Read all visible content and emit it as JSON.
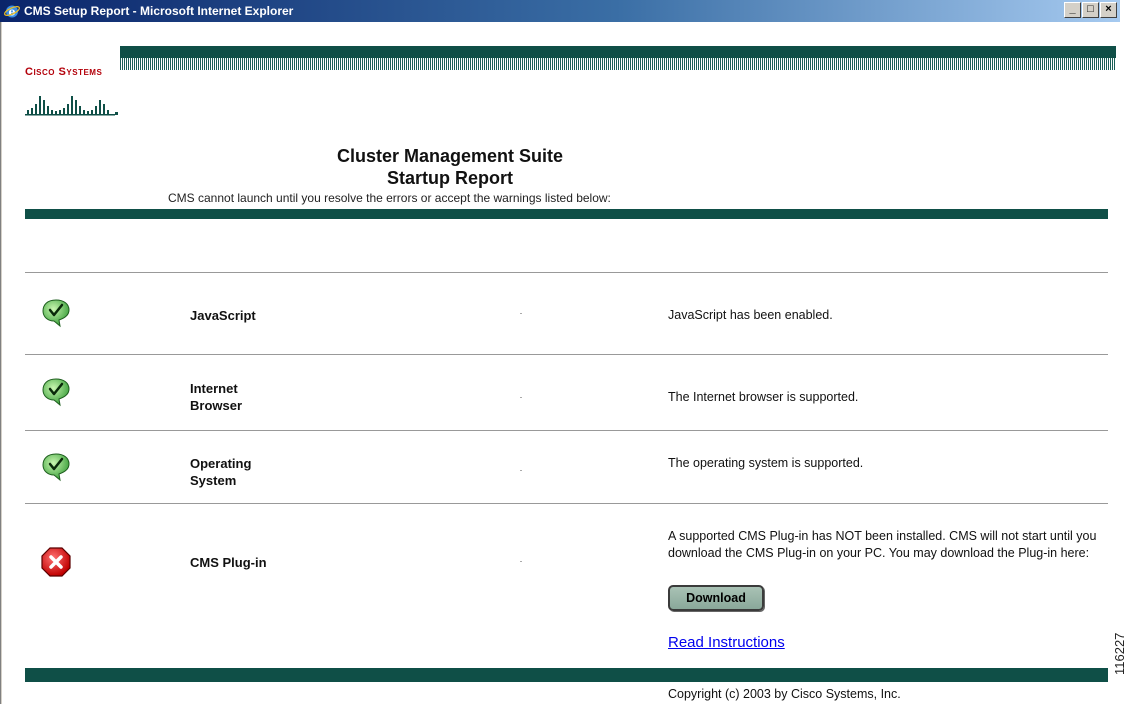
{
  "window": {
    "title": "CMS Setup Report - Microsoft Internet Explorer",
    "buttons": [
      "_",
      "□",
      "×"
    ]
  },
  "logo": {
    "text": "Cisco Systems"
  },
  "header": {
    "title_line1": "Cluster Management Suite",
    "title_line2": "Startup Report",
    "subtitle": "CMS cannot launch until you resolve the errors or accept the warnings listed below:"
  },
  "checks": [
    {
      "status": "ok",
      "name": "JavaScript",
      "message": "JavaScript has been enabled."
    },
    {
      "status": "ok",
      "name": "Internet Browser",
      "message": "The Internet browser is supported."
    },
    {
      "status": "ok",
      "name": "Operating System",
      "message": "The operating system is supported."
    },
    {
      "status": "error",
      "name": "CMS Plug-in",
      "message": "A supported CMS Plug-in has NOT been installed. CMS will not start until you download the CMS Plug-in on your PC. You may download the Plug-in here:"
    }
  ],
  "actions": {
    "download_label": "Download",
    "instructions_link": "Read Instructions"
  },
  "footer": {
    "copyright": "Copyright (c) 2003 by Cisco Systems, Inc."
  },
  "figure_id": "116227",
  "colors": {
    "brand_green": "#0f4f47",
    "ok_green": "#4fb34f",
    "error_red": "#e0161c",
    "link": "#0000ee"
  },
  "icons": {
    "ok": "checkmark-bubble-icon",
    "error": "error-x-icon"
  }
}
